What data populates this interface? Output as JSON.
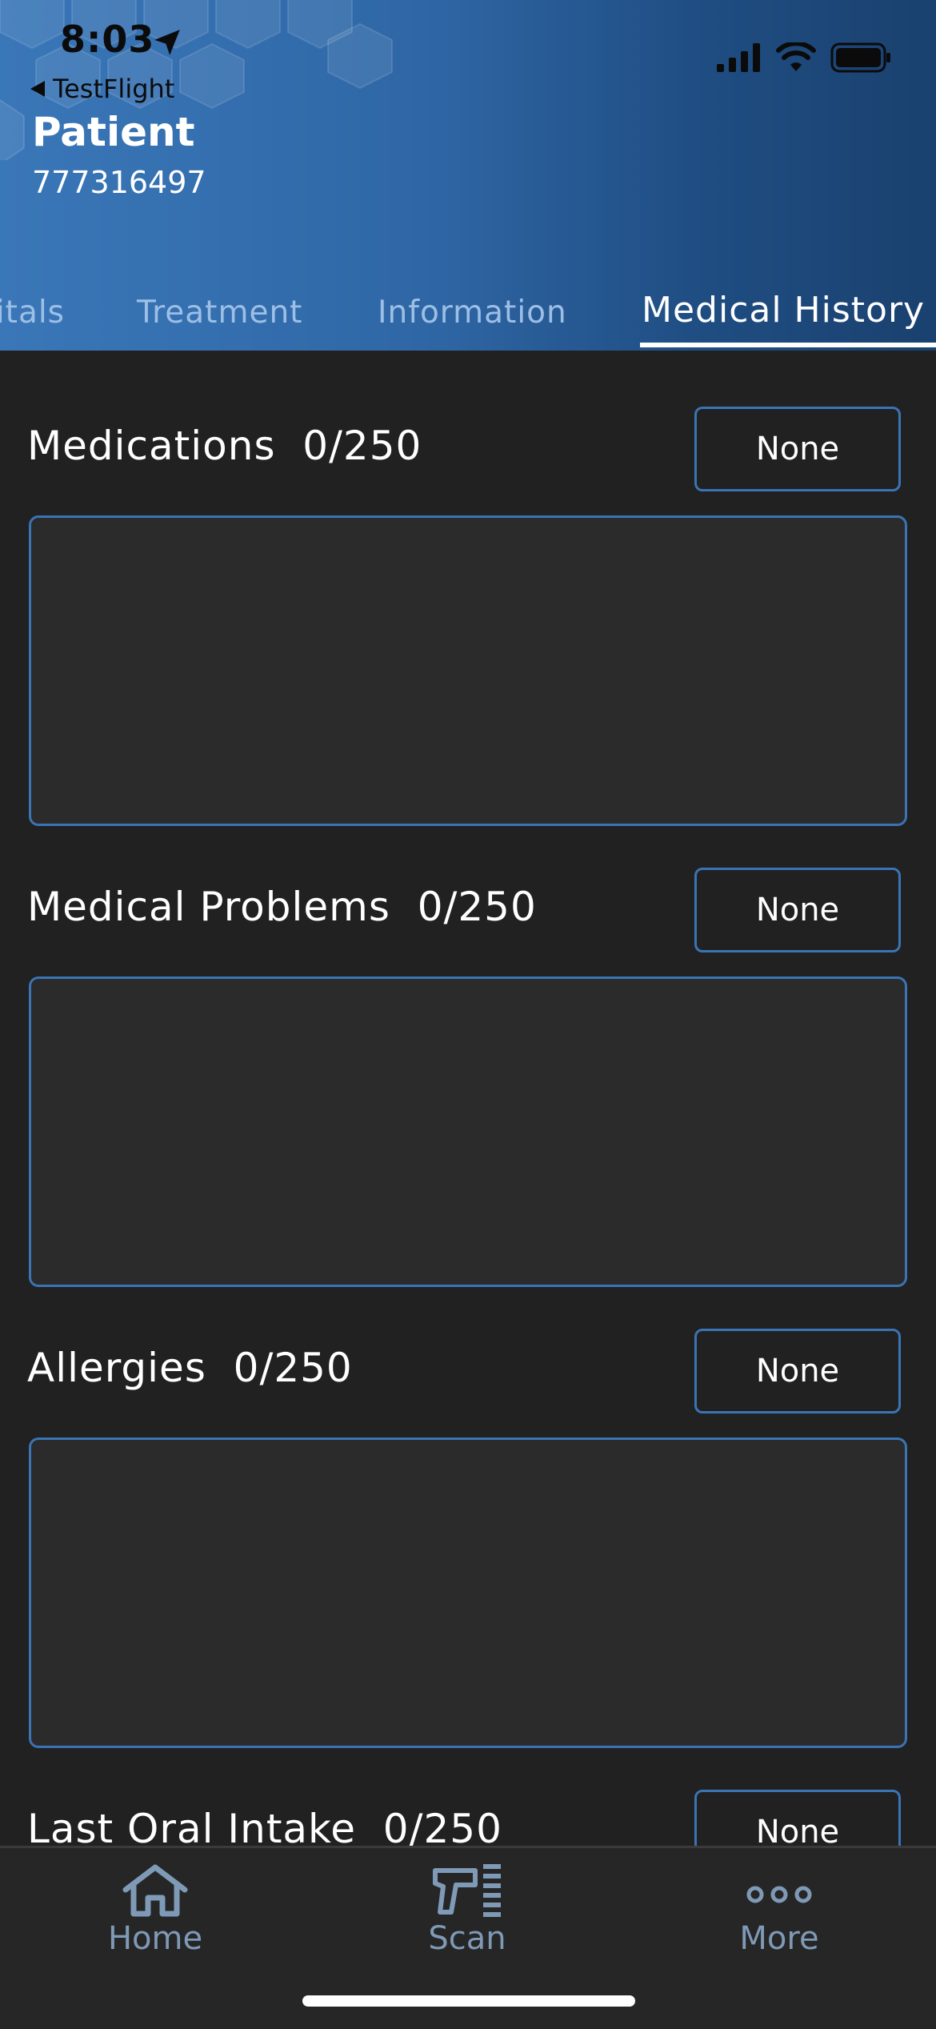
{
  "status_bar": {
    "time": "8:03",
    "back_label": "TestFlight"
  },
  "header": {
    "title": "Patient",
    "patient_id": "777316497"
  },
  "tabs": [
    {
      "label": "Vitals"
    },
    {
      "label": "Treatment"
    },
    {
      "label": "Information"
    },
    {
      "label": "Medical History",
      "active": true
    }
  ],
  "sections": [
    {
      "label": "Medications  0/250",
      "button": "None",
      "value": ""
    },
    {
      "label": "Medical Problems  0/250",
      "button": "None",
      "value": ""
    },
    {
      "label": "Allergies  0/250",
      "button": "None",
      "value": ""
    },
    {
      "label": "Last Oral Intake  0/250",
      "button": "None",
      "value": ""
    }
  ],
  "bottom_nav": [
    {
      "label": "Home",
      "icon": "house-icon"
    },
    {
      "label": "Scan",
      "icon": "barcode-scanner-icon"
    },
    {
      "label": "More",
      "icon": "more-dots-icon"
    }
  ],
  "colors": {
    "accent": "#3a74b4",
    "background": "#212122",
    "nav_icon": "#7f9ab6"
  }
}
